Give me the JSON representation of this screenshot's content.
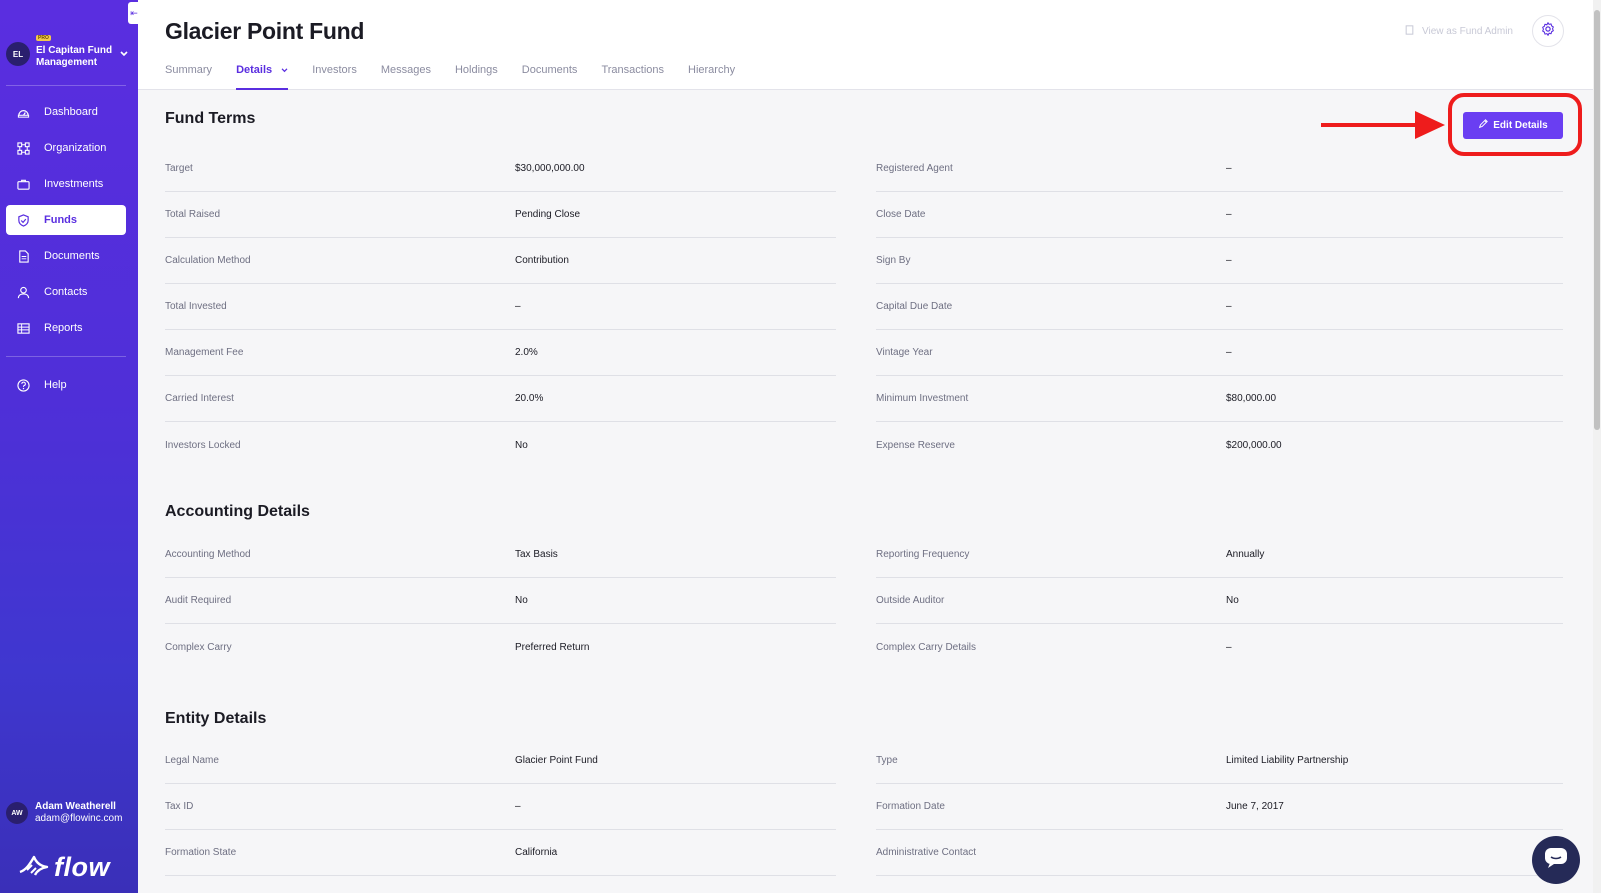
{
  "sidebar": {
    "collapse_glyph": "⇤",
    "org": {
      "initials": "EL",
      "badge": "PRO",
      "name": "El Capitan Fund Management"
    },
    "nav": [
      {
        "label": "Dashboard",
        "icon": "dashboard-icon"
      },
      {
        "label": "Organization",
        "icon": "organization-icon"
      },
      {
        "label": "Investments",
        "icon": "briefcase-icon"
      },
      {
        "label": "Funds",
        "icon": "shield-check-icon",
        "active": true
      },
      {
        "label": "Documents",
        "icon": "document-icon"
      },
      {
        "label": "Contacts",
        "icon": "person-icon"
      },
      {
        "label": "Reports",
        "icon": "table-icon"
      }
    ],
    "help": {
      "label": "Help",
      "icon": "help-circle-icon"
    },
    "user": {
      "initials": "AW",
      "name": "Adam Weatherell",
      "email": "adam@flowinc.com"
    },
    "logo": {
      "word": "flow"
    }
  },
  "header": {
    "title": "Glacier Point Fund",
    "tabs": [
      "Summary",
      "Details",
      "Investors",
      "Messages",
      "Holdings",
      "Documents",
      "Transactions",
      "Hierarchy"
    ],
    "active_tab": "Details",
    "admin_link": "View as Fund Admin"
  },
  "fund_terms": {
    "title": "Fund Terms",
    "edit_button": "Edit Details",
    "left": [
      {
        "label": "Target",
        "value": "$30,000,000.00"
      },
      {
        "label": "Total Raised",
        "value": "Pending Close"
      },
      {
        "label": "Calculation Method",
        "value": "Contribution"
      },
      {
        "label": "Total Invested",
        "value": "–"
      },
      {
        "label": "Management Fee",
        "value": "2.0%"
      },
      {
        "label": "Carried Interest",
        "value": "20.0%"
      },
      {
        "label": "Investors Locked",
        "value": "No"
      }
    ],
    "right": [
      {
        "label": "Registered Agent",
        "value": "–"
      },
      {
        "label": "Close Date",
        "value": "–"
      },
      {
        "label": "Sign By",
        "value": "–"
      },
      {
        "label": "Capital Due Date",
        "value": "–"
      },
      {
        "label": "Vintage Year",
        "value": "–"
      },
      {
        "label": "Minimum Investment",
        "value": "$80,000.00"
      },
      {
        "label": "Expense Reserve",
        "value": "$200,000.00"
      }
    ]
  },
  "accounting": {
    "title": "Accounting Details",
    "left": [
      {
        "label": "Accounting Method",
        "value": "Tax Basis"
      },
      {
        "label": "Audit Required",
        "value": "No"
      },
      {
        "label": "Complex Carry",
        "value": "Preferred Return"
      }
    ],
    "right": [
      {
        "label": "Reporting Frequency",
        "value": "Annually"
      },
      {
        "label": "Outside Auditor",
        "value": "No"
      },
      {
        "label": "Complex Carry Details",
        "value": "–"
      }
    ]
  },
  "entity": {
    "title": "Entity Details",
    "left": [
      {
        "label": "Legal Name",
        "value": "Glacier Point Fund"
      },
      {
        "label": "Tax ID",
        "value": "–"
      },
      {
        "label": "Formation State",
        "value": "California"
      }
    ],
    "right": [
      {
        "label": "Type",
        "value": "Limited Liability Partnership"
      },
      {
        "label": "Formation Date",
        "value": "June 7, 2017"
      },
      {
        "label": "Administrative Contact",
        "value": ""
      }
    ]
  },
  "colors": {
    "accent": "#5a2ee0",
    "button": "#6a3ef2",
    "annotation": "#ee1c1c",
    "chat": "#252a57"
  }
}
